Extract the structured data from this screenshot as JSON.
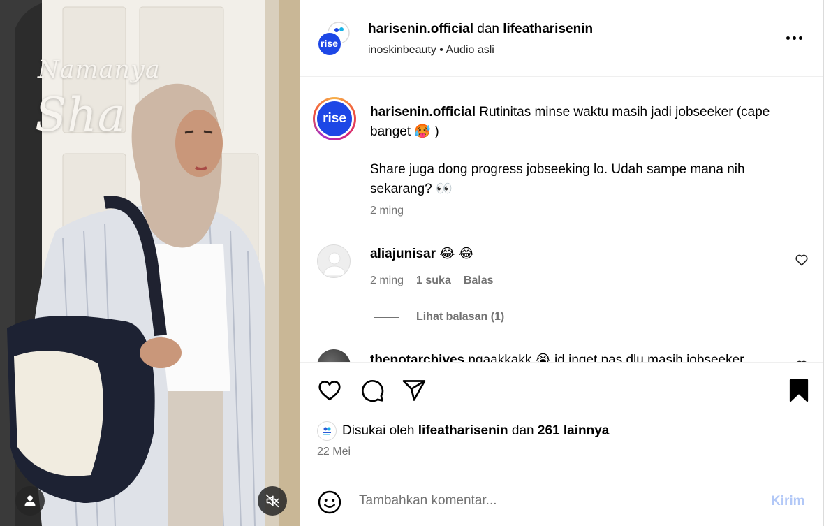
{
  "media": {
    "overlay_line1": "Namanya",
    "overlay_line2": "Sha",
    "buttons": {
      "user_icon": "user-icon",
      "mute_icon": "speaker-muted-icon"
    }
  },
  "header": {
    "author": "harisenin.official",
    "joiner": "dan",
    "coauthor": "lifeatharisenin",
    "audio_owner": "inoskinbeauty",
    "separator": "•",
    "audio_label": "Audio asli",
    "avatar_label": "rise"
  },
  "caption": {
    "username": "harisenin.official",
    "line1": "Rutinitas minse waktu masih jadi jobseeker (cape banget 🥵 )",
    "line2": "Share juga dong progress jobseeking lo. Udah sampe mana nih sekarang? 👀",
    "time": "2 ming"
  },
  "comments": [
    {
      "username": "aliajunisar",
      "text": "😂 😂",
      "time": "2 ming",
      "likes": "1 suka",
      "reply_label": "Balas",
      "view_replies": "Lihat balasan (1)"
    },
    {
      "username": "thepotarchives",
      "text": "ngaakkakk 😭 id inget pas dlu masih jobseeker"
    }
  ],
  "actions": {
    "liked_prefix": "Disukai oleh",
    "liked_user": "lifeatharisenin",
    "liked_joiner": "dan",
    "liked_others": "261 lainnya",
    "date": "22 Mei"
  },
  "composer": {
    "placeholder": "Tambahkan komentar...",
    "post_label": "Kirim"
  },
  "colors": {
    "brand_blue": "#1d47e6",
    "link_blue_disabled": "#b2c8f7",
    "muted": "#737373"
  }
}
